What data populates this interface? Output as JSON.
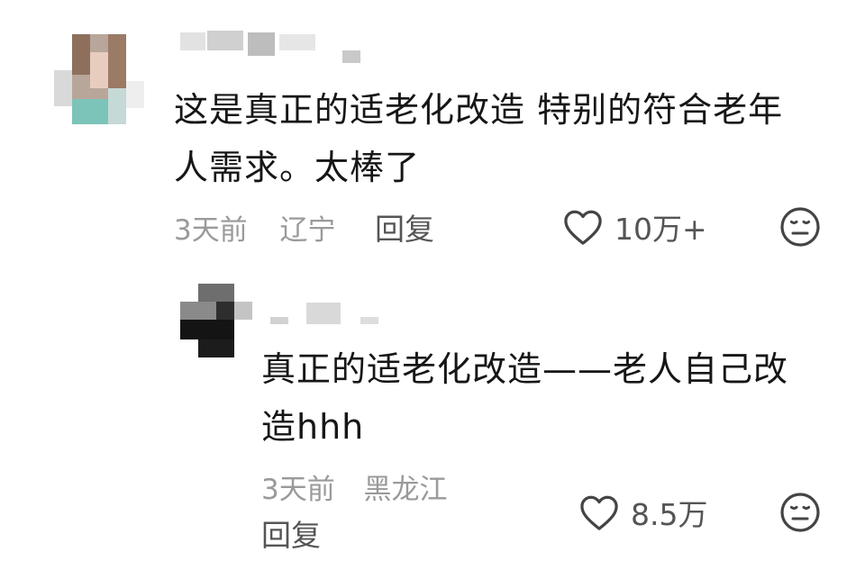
{
  "comments": [
    {
      "text_line1": "这是真正的适老化改造 特别的符合老年",
      "text_line2": "人需求。太棒了",
      "time": "3天前",
      "location": "辽宁",
      "reply_label": "回复",
      "likes": "10万+"
    },
    {
      "text_line1": "真正的适老化改造——老人自己改",
      "text_line2": "造hhh",
      "time": "3天前",
      "location": "黑龙江",
      "reply_label": "回复",
      "likes": "8.5万"
    }
  ],
  "icons": {
    "like": "heart-outline-icon",
    "reaction": "meh-face-icon"
  },
  "colors": {
    "text": "#161616",
    "meta": "#9a9a9a",
    "action": "#555555"
  }
}
